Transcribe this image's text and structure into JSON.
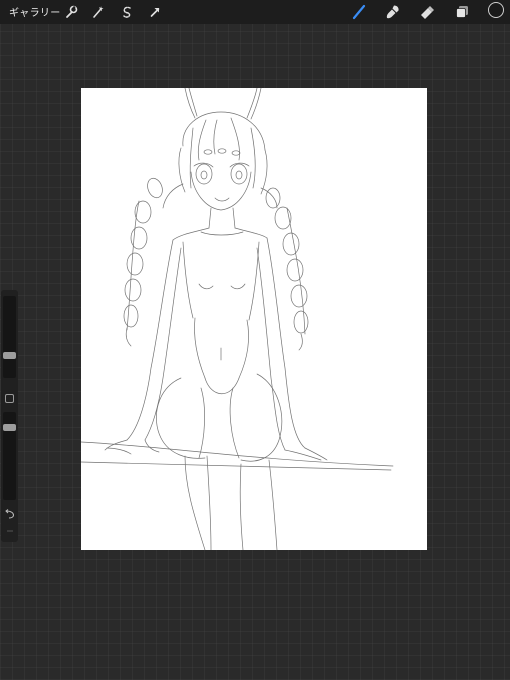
{
  "topbar": {
    "gallery_label": "ギャラリー",
    "left_tools": [
      "wrench-icon",
      "magic-wand-icon",
      "selection-icon",
      "transform-arrow-icon"
    ],
    "right_tools": [
      "brush-icon",
      "smudge-icon",
      "eraser-icon",
      "layers-icon"
    ],
    "active_tool": "brush-icon",
    "accent_color": "#3a8df5",
    "current_color": "#1a1a1a"
  },
  "sidebar": {
    "brush_size_level": 0.28,
    "opacity_level": 0.1,
    "icons": [
      "modify-square-icon",
      "undo-icon",
      "redo-icon"
    ]
  },
  "canvas": {
    "background_color": "#ffffff",
    "subject": "pencil-sketch-of-seated-figure"
  }
}
